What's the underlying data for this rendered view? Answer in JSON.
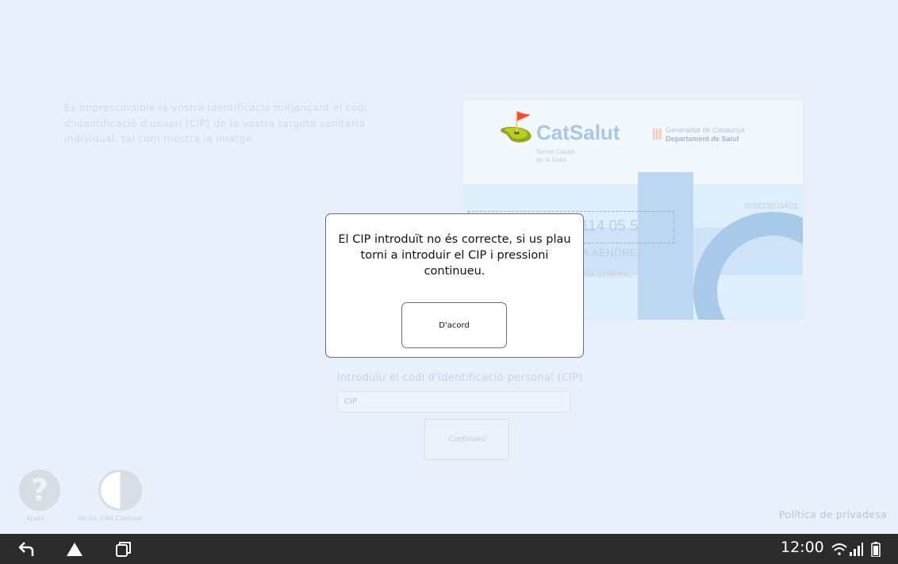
{
  "intro": {
    "text": "És imprescindible la vostra identificació mitjançant el codi d'identificació d'usuari (CIP) de la vostra targeta sanitària individual, tal com mostra la imatge."
  },
  "card_image": {
    "brand": "CatSalut",
    "brand_sub_1": "Servei Català",
    "brand_sub_2": "de la Salut",
    "gov_1": "Generalitat de Catalunya",
    "gov_2": "Departament de Salut",
    "card_number": "00000803401",
    "cip_fragment": "114 05 5",
    "name_fragment": "A AENDREL",
    "category_fragment": "RIA GENERAL"
  },
  "form": {
    "cip_label": "Introduïu el codi d'identificació personal (CIP)",
    "cip_placeholder": "CIP",
    "cip_value": "",
    "continue_label": "Continueu"
  },
  "accessibility": {
    "help_glyph": "?",
    "help_label": "Ajuda",
    "contrast_label": "Versió d'Alt Contrast"
  },
  "footer": {
    "privacy_label": "Política de privadesa"
  },
  "dialog": {
    "message": "El CIP introduït no és correcte, si us plau torni a introduir el CIP i pressioni continueu.",
    "ok_label": "D'acord"
  },
  "system_bar": {
    "time": "12:00",
    "icons": [
      "back-icon",
      "home-icon",
      "recent-apps-icon",
      "wifi-icon",
      "signal-icon",
      "battery-icon"
    ]
  },
  "colors": {
    "background": "#e8f0fb",
    "navbar": "#2b2b2b",
    "dialog_border": "#6e6e6e"
  }
}
